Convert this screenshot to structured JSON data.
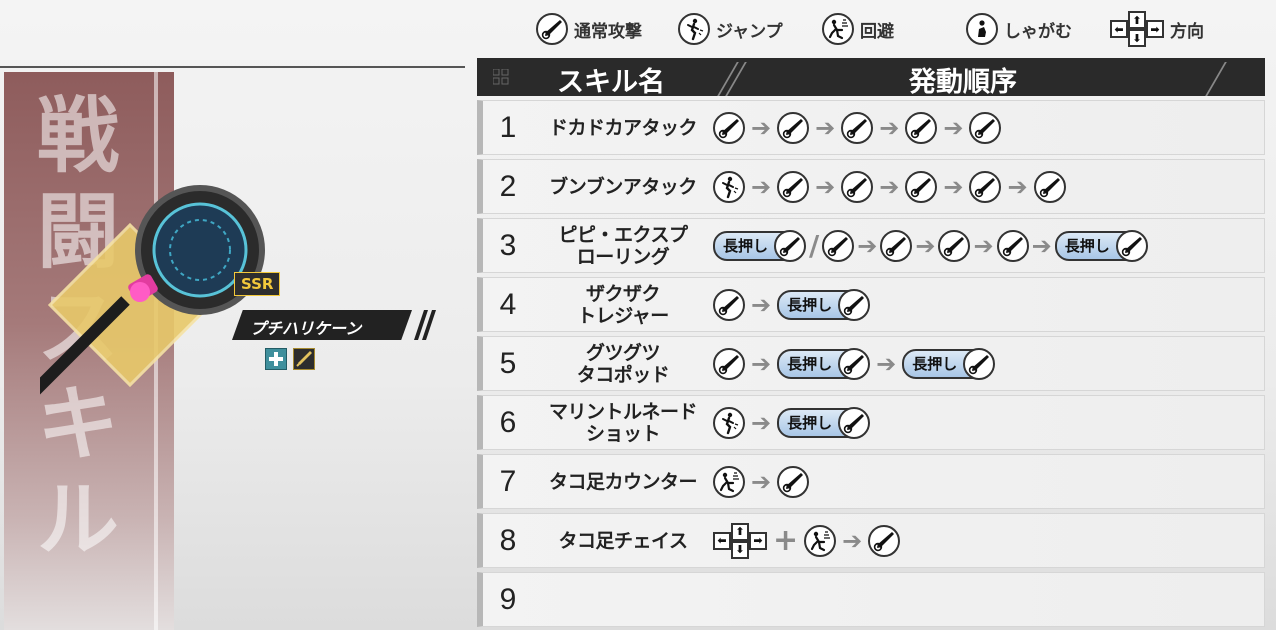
{
  "legend": [
    {
      "icon": "sword-icon",
      "label": "通常攻撃"
    },
    {
      "icon": "jump-icon",
      "label": "ジャンプ"
    },
    {
      "icon": "dodge-icon",
      "label": "回避"
    },
    {
      "icon": "crouch-icon",
      "label": "しゃがむ"
    },
    {
      "icon": "direction-keys-icon",
      "label": "方向"
    }
  ],
  "side": {
    "title_chars": [
      "戦",
      "闘",
      "ス",
      "キ",
      "ル"
    ],
    "rarity": "SSR",
    "weapon_name": "プチハリケーン"
  },
  "table": {
    "header_name": "スキル名",
    "header_sequence": "発動順序",
    "hold_label": "長押し",
    "rows": [
      {
        "num": "1",
        "name": [
          "ドカドカアタック"
        ]
      },
      {
        "num": "2",
        "name": [
          "ブンブンアタック"
        ]
      },
      {
        "num": "3",
        "name": [
          "ピピ・エクスプ",
          "ローリング"
        ]
      },
      {
        "num": "4",
        "name": [
          "ザクザク",
          "トレジャー"
        ]
      },
      {
        "num": "5",
        "name": [
          "グツグツ",
          "タコポッド"
        ]
      },
      {
        "num": "6",
        "name": [
          "マリントルネード",
          "ショット"
        ]
      },
      {
        "num": "7",
        "name": [
          "タコ足カウンター"
        ]
      },
      {
        "num": "8",
        "name": [
          "タコ足チェイス"
        ]
      },
      {
        "num": "9",
        "name": [
          ""
        ]
      }
    ]
  },
  "colors": {
    "header_bg": "#2a2a2a",
    "panel": "#8e5c5c",
    "hold_pill": "#a8c6e6",
    "rarity_text": "#f3c93b"
  }
}
